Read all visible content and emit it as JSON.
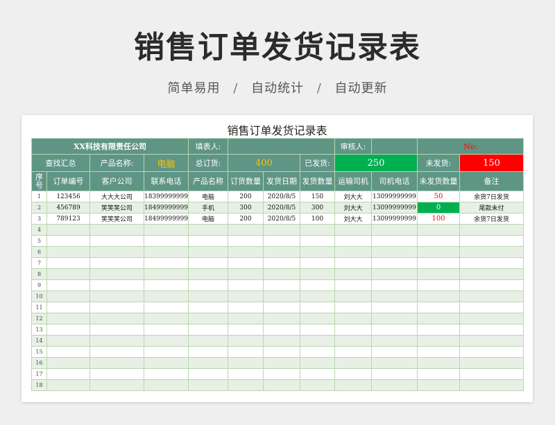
{
  "banner": {
    "title": "销售订单发货记录表",
    "tags": [
      "简单易用",
      "自动统计",
      "自动更新"
    ],
    "separator": "/"
  },
  "sheet": {
    "title": "销售订单发货记录表",
    "info_row": {
      "company": "XX科技有限责任公司",
      "filler_label": "填表人:",
      "filler_value": "",
      "reviewer_label": "审核人:",
      "reviewer_value": "",
      "no_label": "No:"
    },
    "summary_row": {
      "lookup_label": "查找汇总",
      "product_label": "产品名称:",
      "product_value": "电脑",
      "total_label": "总订货:",
      "total_value": "400",
      "shipped_label": "已发货:",
      "shipped_value": "250",
      "pending_label": "未发货:",
      "pending_value": "150"
    },
    "columns": [
      "序号",
      "订单编号",
      "客户公司",
      "联系电话",
      "产品名称",
      "订货数量",
      "发货日期",
      "发货数量",
      "运输司机",
      "司机电话",
      "未发货数量",
      "备注"
    ],
    "rows": [
      {
        "idx": "1",
        "order": "123456",
        "client": "大大大公司",
        "phone": "18399999999",
        "product": "电脑",
        "qty": "200",
        "date": "2020/8/5",
        "shipped": "150",
        "driver": "刘大大",
        "driver_phone": "13099999999",
        "pending": "50",
        "note": "余货7日发货",
        "status": "red"
      },
      {
        "idx": "2",
        "order": "456789",
        "client": "笑笑笑公司",
        "phone": "18499999999",
        "product": "手机",
        "qty": "300",
        "date": "2020/8/5",
        "shipped": "300",
        "driver": "刘大大",
        "driver_phone": "13099999999",
        "pending": "0",
        "note": "尾款未付",
        "status": "zero"
      },
      {
        "idx": "3",
        "order": "789123",
        "client": "笑笑笑公司",
        "phone": "18499999999",
        "product": "电脑",
        "qty": "200",
        "date": "2020/8/5",
        "shipped": "100",
        "driver": "刘大大",
        "driver_phone": "13099999999",
        "pending": "100",
        "note": "余货7日发货",
        "status": "red"
      },
      {
        "idx": "4"
      },
      {
        "idx": "5"
      },
      {
        "idx": "6"
      },
      {
        "idx": "7"
      },
      {
        "idx": "8"
      },
      {
        "idx": "9"
      },
      {
        "idx": "10"
      },
      {
        "idx": "11"
      },
      {
        "idx": "12"
      },
      {
        "idx": "13"
      },
      {
        "idx": "14"
      },
      {
        "idx": "15"
      },
      {
        "idx": "16"
      },
      {
        "idx": "17"
      },
      {
        "idx": "18"
      }
    ]
  }
}
